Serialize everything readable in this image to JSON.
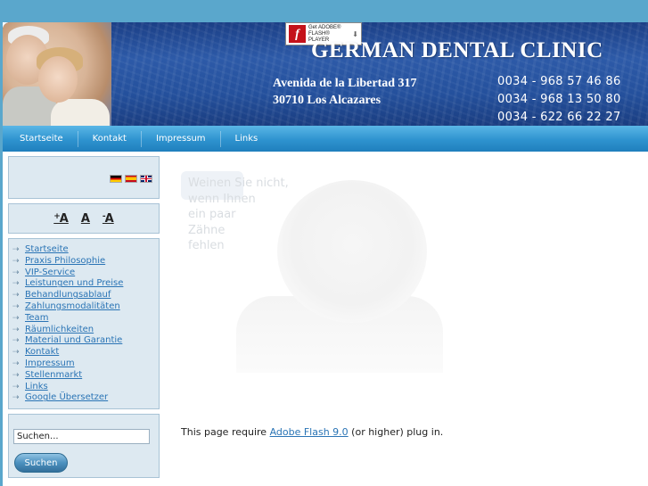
{
  "header": {
    "title": "GERMAN DENTAL CLINIC",
    "address_line1": "Avenida de la Libertad 317",
    "address_line2": "30710 Los Alcazares",
    "phones": [
      "0034 - 968 57 46 86",
      "0034 - 968 13 50 80",
      "0034 - 622 66 22 27"
    ],
    "flash_badge": {
      "line1": "Get ADOBE®",
      "line2": "FLASH® PLAYER",
      "logo_letter": "f"
    }
  },
  "nav": {
    "items": [
      "Startseite",
      "Kontakt",
      "Impressum",
      "Links"
    ]
  },
  "sidebar": {
    "flags": [
      "de",
      "es",
      "uk"
    ],
    "fontsize": {
      "increase": "A",
      "normal": "A",
      "decrease": "A",
      "plus": "+",
      "minus": "-"
    },
    "menu": [
      "Startseite",
      "Praxis Philosophie",
      "VIP-Service",
      "Leistungen und Preise",
      "Behandlungsablauf",
      "Zahlungsmodalitäten",
      "Team",
      "Räumlichkeiten",
      "Material und Garantie",
      "Kontakt",
      "Impressum",
      "Stellenmarkt",
      "Links",
      "Google Übersetzer"
    ],
    "search": {
      "value": "Suchen...",
      "button": "Suchen"
    }
  },
  "main": {
    "banner_text": [
      "Weinen Sie nicht,",
      "wenn Ihnen",
      "ein paar",
      "Zähne",
      "fehlen"
    ],
    "require_prefix": "This page require ",
    "require_link": "Adobe Flash 9.0",
    "require_suffix": " (or higher) plug in."
  },
  "colors": {
    "background": "#5aa7cc",
    "header": "#24509c",
    "nav": "#2e93cf",
    "sidebar_box": "#dde9f1",
    "link": "#2a74b5"
  }
}
